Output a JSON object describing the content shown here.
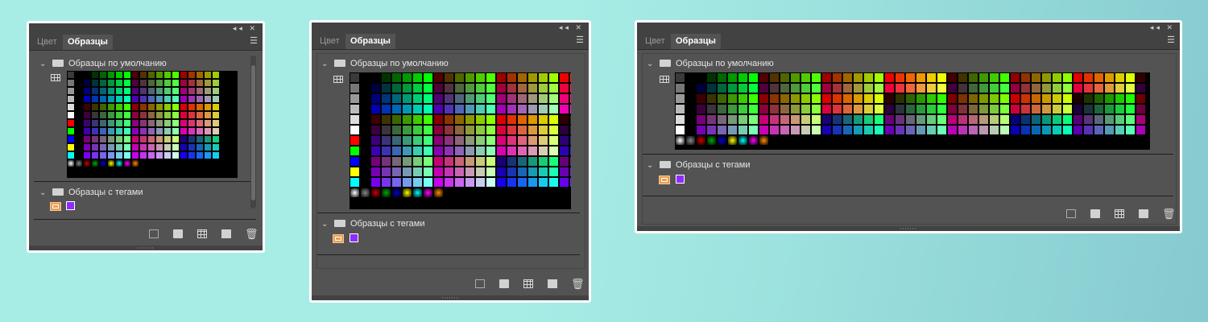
{
  "panels": [
    {
      "tabs": [
        "Цвет",
        "Образцы"
      ],
      "groups": [
        {
          "label": "Образцы по умолчанию"
        },
        {
          "label": "Образцы с тегами"
        }
      ]
    },
    {
      "tabs": [
        "Цвет",
        "Образцы"
      ],
      "groups": [
        {
          "label": "Образцы по умолчанию"
        },
        {
          "label": "Образцы с тегами"
        }
      ]
    },
    {
      "tabs": [
        "Цвет",
        "Образцы"
      ],
      "groups": [
        {
          "label": "Образцы по умолчанию"
        },
        {
          "label": "Образцы с тегами"
        }
      ]
    }
  ],
  "icons": {
    "collapse": "double-chevron-left-icon",
    "close": "close-icon",
    "menu": "hamburger-menu-icon",
    "folder": "folder-icon",
    "grid_view": "grid-view-icon",
    "footer": [
      "new-swatch-icon",
      "new-group-icon",
      "grid-view-icon",
      "new-page-icon",
      "trash-icon"
    ]
  },
  "colors": {
    "panel_bg": "#535353",
    "tab_bg": "#424242",
    "tag_swatch": "#8e2bff",
    "tag_icon": "#ec9d52"
  }
}
